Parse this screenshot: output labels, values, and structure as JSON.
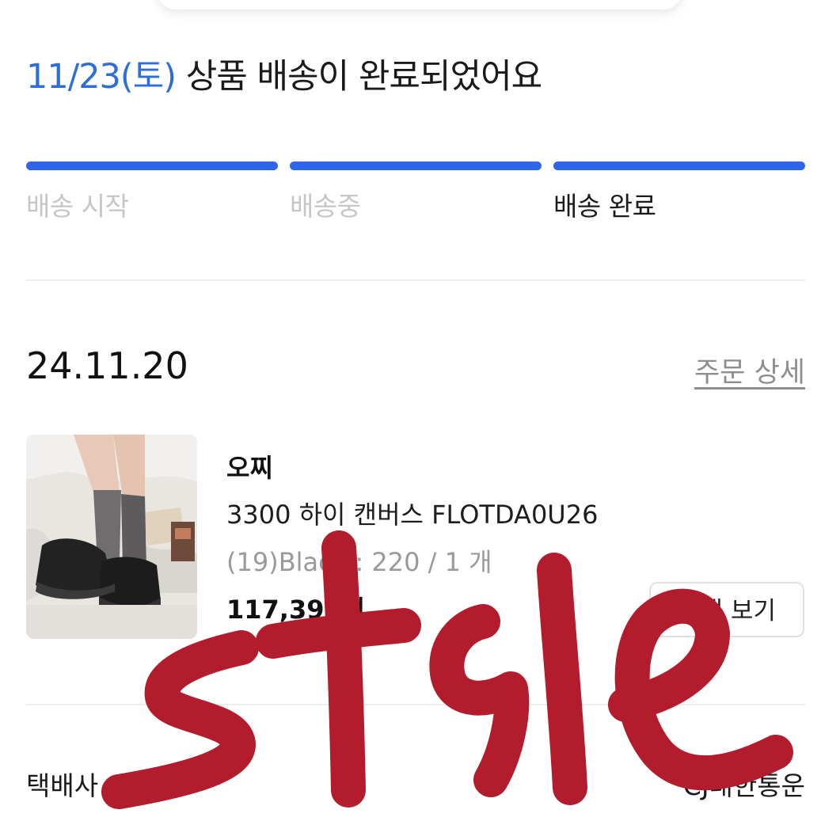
{
  "header": {
    "delivery_date": "11/23(토)",
    "delivery_message": "상품 배송이 완료되었어요"
  },
  "progress": {
    "steps": [
      "배송 시작",
      "배송중",
      "배송 완료"
    ],
    "current_step": "배송 완료",
    "color": "#2d66ea"
  },
  "order": {
    "date": "24.11.20",
    "detail_link": "주문 상세",
    "product": {
      "brand": "오찌",
      "name": "3300 하이 캔버스 FLOTDA0U26",
      "option": "(19)Black : 220 / 1 개",
      "price": "117,390원"
    },
    "snap_button": "스냅 보기"
  },
  "courier": {
    "label": "택배사",
    "value": "CJ대한통운"
  },
  "watermark": {
    "text": "style",
    "color": "#b31c2c"
  }
}
